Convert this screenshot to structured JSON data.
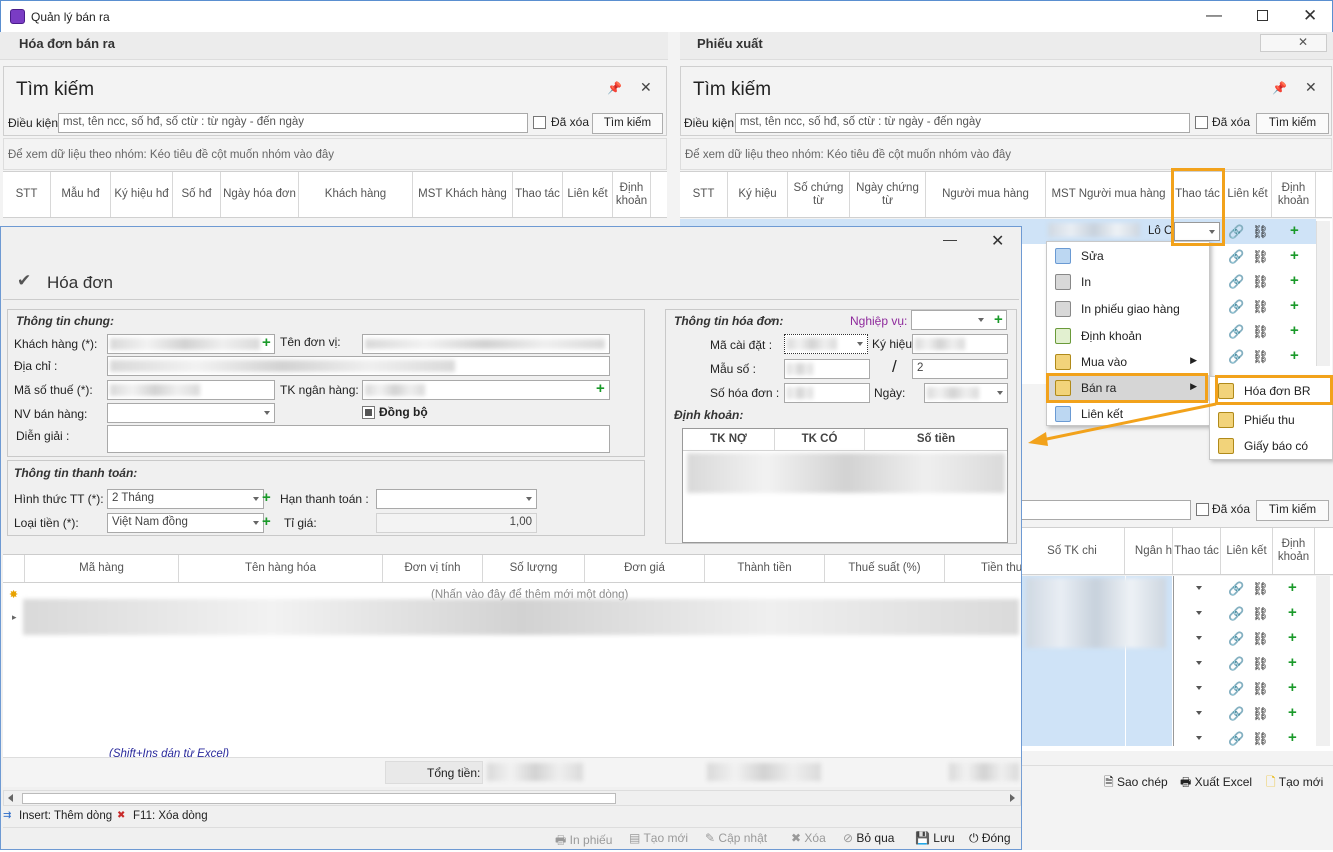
{
  "app": {
    "title": "Quản lý bán ra",
    "left_panel_title": "Hóa đơn bán ra",
    "right_panel_title": "Phiếu xuất"
  },
  "left_search": {
    "title": "Tìm kiếm",
    "condition_label": "Điều kiện:",
    "placeholder": "mst, tên ncc, số hđ, số ctừ : từ ngày - đến ngày",
    "deleted_label": "Đã xóa",
    "search_button": "Tìm kiếm",
    "group_hint": "Để xem dữ liệu theo nhóm: Kéo tiêu đề cột muốn nhóm vào đây",
    "columns": [
      "STT",
      "Mẫu hđ",
      "Ký hiệu hđ",
      "Số hđ",
      "Ngày hóa đơn",
      "Khách hàng",
      "MST Khách hàng",
      "Thao tác",
      "Liên kết",
      "Định khoản"
    ]
  },
  "right_search": {
    "title": "Tìm kiếm",
    "condition_label": "Điều kiện:",
    "placeholder": "mst, tên ncc, số hđ, số ctừ : từ ngày - đến ngày",
    "deleted_label": "Đã xóa",
    "search_button": "Tìm kiếm",
    "group_hint": "Để xem dữ liệu theo nhóm: Kéo tiêu đề cột muốn nhóm vào đây",
    "columns": [
      "STT",
      "Ký hiệu",
      "Số chứng từ",
      "Ngày chứng từ",
      "Người mua hàng",
      "MST Người mua hàng",
      "Thao tác",
      "Liên kết",
      "Định khoản"
    ],
    "row_text": "Lô C"
  },
  "lower_right": {
    "deleted_label": "Đã xóa",
    "search_button": "Tìm kiếm",
    "columns": [
      "Số TK chi",
      "Ngân h",
      "Thao tác",
      "Liên kết",
      "Định khoản"
    ],
    "toolbar": {
      "copy": "Sao chép",
      "export": "Xuất Excel",
      "new": "Tạo mới"
    }
  },
  "context_menu": {
    "items": [
      "Sửa",
      "In",
      "In phiếu giao hàng",
      "Định khoản",
      "Mua vào",
      "Bán ra",
      "Liên kết"
    ],
    "submenu": [
      "Hóa đơn BR",
      "Phiếu thu",
      "Giấy báo có"
    ]
  },
  "dialog": {
    "title": "Hóa đơn",
    "general_section": "Thông tin chung:",
    "customer_label": "Khách hàng (*):",
    "unit_name_label": "Tên đơn vị:",
    "address_label": "Địa chỉ :",
    "tax_code_label": "Mã số thuế (*):",
    "bank_account_label": "TK ngân hàng:",
    "salesperson_label": "NV bán hàng:",
    "sync_label": "Đồng bộ",
    "description_label": "Diễn giải :",
    "payment_section": "Thông tin thanh toán:",
    "payment_method_label": "Hình thức TT (*):",
    "payment_method_value": "2 Tháng",
    "due_label": "Hạn thanh toán :",
    "currency_label": "Loại tiền (*):",
    "currency_value": "Việt Nam đồng",
    "rate_label": "Tỉ giá:",
    "rate_value": "1,00",
    "invoice_section": "Thông tin hóa đơn:",
    "business_label": "Nghiệp vụ:",
    "setup_code_label": "Mã cài đặt :",
    "symbol_label": "Ký hiệu:",
    "form_label": "Mẫu số :",
    "form_slash": "/",
    "form_suffix": "2",
    "invoice_no_label": "Số hóa đơn :",
    "date_label": "Ngày:",
    "accounting_section": "Định khoản:",
    "acc_columns": [
      "TK NỢ",
      "TK CÓ",
      "Số tiền"
    ],
    "grid_columns": [
      "Mã hàng",
      "Tên hàng hóa",
      "Đơn vị tính",
      "Số lượng",
      "Đơn giá",
      "Thành tiền",
      "Thuế suất (%)",
      "Tiền thu"
    ],
    "new_row_hint": "(Nhấn vào đây để thêm mới một dòng)",
    "paste_hint": "(Shift+Ins dán từ Excel)",
    "total_label": "Tổng tiền:",
    "insert_hint": "Insert: Thêm dòng",
    "delete_hint": "F11: Xóa dòng",
    "buttons": {
      "print": "In phiếu",
      "new": "Tạo mới",
      "update": "Cập nhật",
      "delete": "Xóa",
      "skip": "Bỏ qua",
      "save": "Lưu",
      "close": "Đóng"
    }
  }
}
